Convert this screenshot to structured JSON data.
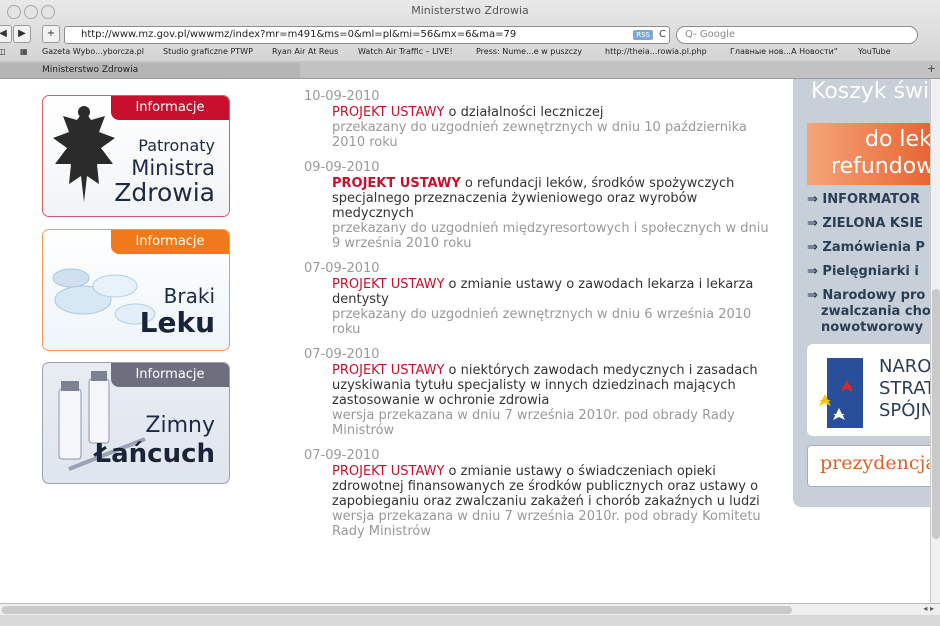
{
  "window": {
    "title": "Ministerstwo Zdrowia"
  },
  "toolbar": {
    "back": "◀",
    "forward": "▶",
    "add": "+",
    "url": "http://www.mz.gov.pl/wwwmz/index?mr=m491&ms=0&ml=pl&mi=56&mx=6&ma=79",
    "rss": "RSS",
    "reload": "C",
    "search_placeholder": "Q- Google"
  },
  "bookmarks": [
    "Gazeta Wybo...yborcza.pl",
    "Studio graficzne PTWP",
    "Ryan Air At Reus",
    "Watch Air Traffic – LIVE!",
    "Press: Nume...e w puszczy",
    "http://theia...rowia.pl.php",
    "Главные нов...А Новости\"",
    "YouTube"
  ],
  "tab": {
    "label": "Ministerstwo Zdrowia"
  },
  "promos": [
    {
      "badge": "Informacje",
      "lines": [
        "Patronaty",
        "Ministra",
        "Zdrowia"
      ]
    },
    {
      "badge": "Informacje",
      "lines": [
        "Braki",
        "Leku"
      ]
    },
    {
      "badge": "Informacje",
      "lines": [
        "Zimny",
        "Łańcuch"
      ]
    }
  ],
  "news": [
    {
      "date": "10-09-2010",
      "title_red": "PROJEKT USTAWY",
      "title_rest": " o działalności leczniczej",
      "status": "przekazany do uzgodnień zewnętrznych w dniu 10 października 2010 roku"
    },
    {
      "date": "09-09-2010",
      "title_red": "PROJEKT USTAWY",
      "title_rest": " o refundacji leków, środków spożywczych specjalnego przeznaczenia żywieniowego oraz wyrobów medycznych",
      "status": "przekazany do uzgodnień międzyresortowych i społecznych w dniu 9 września 2010 roku"
    },
    {
      "date": "07-09-2010",
      "title_red": "PROJEKT USTAWY",
      "title_rest": " o zmianie ustawy o zawodach lekarza i lekarza dentysty",
      "status": "przekazany do uzgodnień zewnętrznych w dniu 6 września 2010 roku"
    },
    {
      "date": "07-09-2010",
      "title_red": "PROJEKT USTAWY",
      "title_rest": " o niektórych zawodach medycznych i zasadach uzyskiwania tytułu specjalisty w innych dziedzinach mających zastosowanie w ochronie zdrowia",
      "status": "wersja przekazana w dniu 7 września 2010r. pod obrady Rady Ministrów"
    },
    {
      "date": "07-09-2010",
      "title_red": "PROJEKT USTAWY",
      "title_rest": " o zmianie ustawy o świadczeniach opieki zdrowotnej finansowanych ze środków publicznych oraz ustawy o zapobieganiu oraz zwalczaniu zakażeń i chorób zakaźnych u ludzi",
      "status": "wersja przekazana w dniu 7 września 2010r. pod obrady Komitetu Rady Ministrów"
    }
  ],
  "sidebar": {
    "header": "Koszyk świa",
    "refund_line1": "do lek",
    "refund_line2": "refundow",
    "links": [
      "⇒ INFORMATOR",
      "⇒ ZIELONA KSIE",
      "⇒ Zamówienia P",
      "⇒ Pielęgniarki i",
      "⇒ Narodowy pro",
      "zwalczania cho",
      "nowotworowy"
    ],
    "logo_text": [
      "NARO",
      "STRAT",
      "SPÓJN"
    ],
    "prez": "prezydencja"
  }
}
